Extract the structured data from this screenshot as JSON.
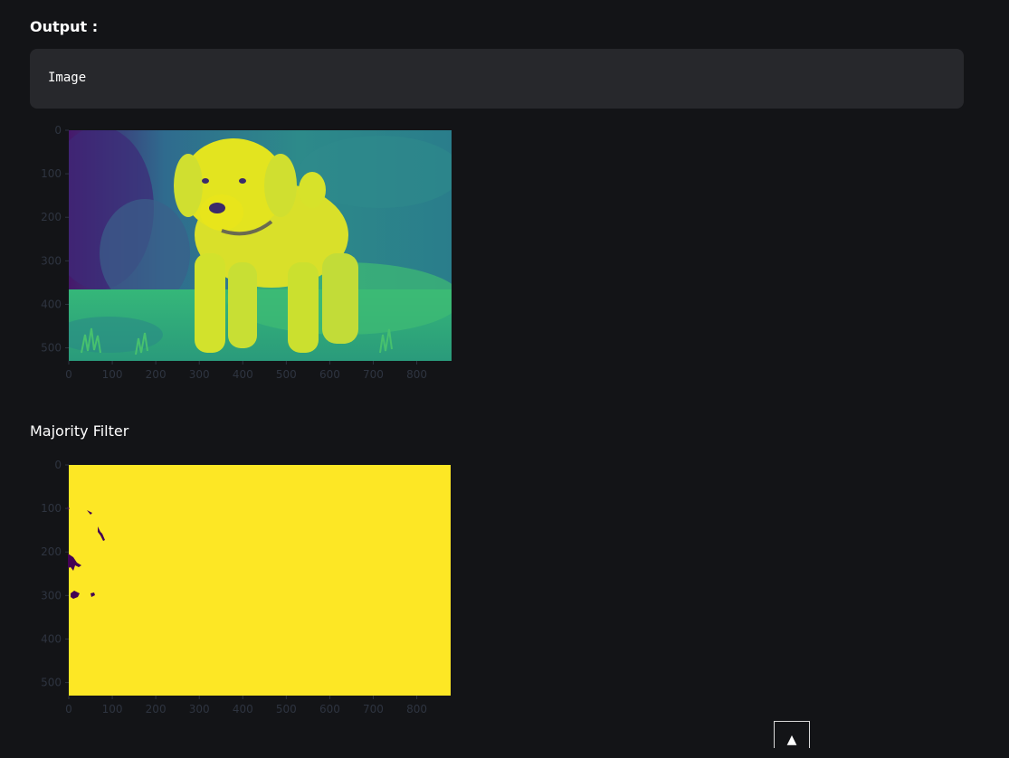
{
  "output_heading": "Output :",
  "code_output": "Image",
  "section_heading": "Majority Filter",
  "scroll_top_icon": "arrow-up-icon",
  "scroll_top_glyph": "▲",
  "chart_data": [
    {
      "type": "image",
      "content": "viridis-colormap grayscale photo of a yellow labrador puppy standing on grass",
      "x_ticks": [
        "0",
        "100",
        "200",
        "300",
        "400",
        "500",
        "600",
        "700",
        "800"
      ],
      "y_ticks": [
        "0",
        "100",
        "200",
        "300",
        "400",
        "500"
      ],
      "xlim": [
        0,
        880
      ],
      "ylim": [
        530,
        0
      ],
      "colormap": "viridis"
    },
    {
      "type": "image",
      "content": "binary majority-filtered image, almost entirely yellow with a few dark purple specks near the left edge",
      "x_ticks": [
        "0",
        "100",
        "200",
        "300",
        "400",
        "500",
        "600",
        "700",
        "800"
      ],
      "y_ticks": [
        "0",
        "100",
        "200",
        "300",
        "400",
        "500"
      ],
      "xlim": [
        0,
        880
      ],
      "ylim": [
        530,
        0
      ],
      "colors": {
        "background": "#fde725",
        "specks": "#440154"
      }
    }
  ]
}
